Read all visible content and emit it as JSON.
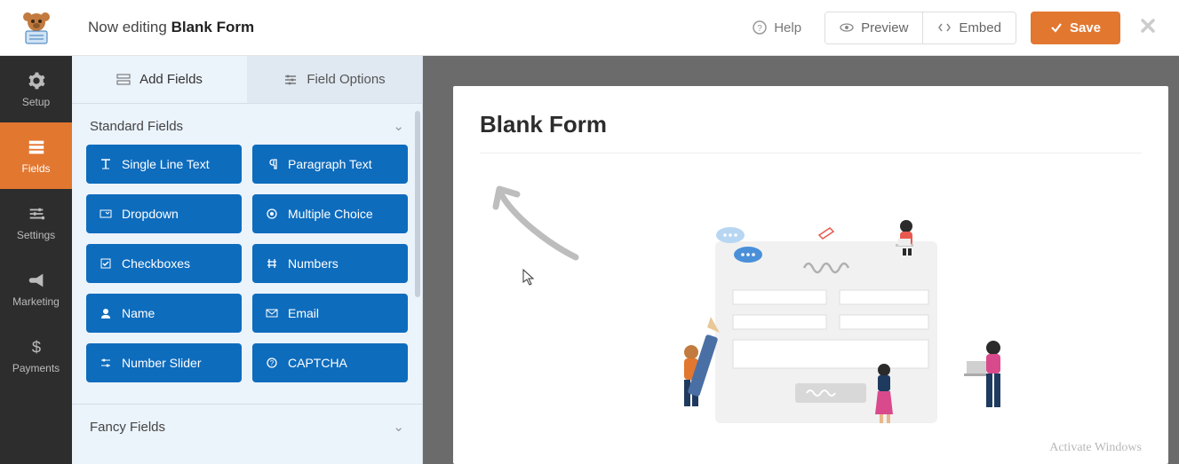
{
  "header": {
    "editing_prefix": "Now editing ",
    "form_name": "Blank Form",
    "help_label": "Help",
    "preview_label": "Preview",
    "embed_label": "Embed",
    "save_label": "Save"
  },
  "vnav": {
    "items": [
      {
        "label": "Setup",
        "icon": "gear-icon"
      },
      {
        "label": "Fields",
        "icon": "form-icon",
        "active": true
      },
      {
        "label": "Settings",
        "icon": "sliders-icon"
      },
      {
        "label": "Marketing",
        "icon": "bullhorn-icon"
      },
      {
        "label": "Payments",
        "icon": "dollar-icon"
      }
    ]
  },
  "panel": {
    "tabs": {
      "add_fields": "Add Fields",
      "field_options": "Field Options"
    },
    "sections": {
      "standard": "Standard Fields",
      "fancy": "Fancy Fields"
    },
    "standard_fields": [
      {
        "label": "Single Line Text",
        "icon": "text-icon"
      },
      {
        "label": "Paragraph Text",
        "icon": "paragraph-icon"
      },
      {
        "label": "Dropdown",
        "icon": "dropdown-icon"
      },
      {
        "label": "Multiple Choice",
        "icon": "radio-icon"
      },
      {
        "label": "Checkboxes",
        "icon": "checkbox-icon"
      },
      {
        "label": "Numbers",
        "icon": "hash-icon"
      },
      {
        "label": "Name",
        "icon": "user-icon"
      },
      {
        "label": "Email",
        "icon": "mail-icon"
      },
      {
        "label": "Number Slider",
        "icon": "slider-icon"
      },
      {
        "label": "CAPTCHA",
        "icon": "captcha-icon"
      }
    ]
  },
  "canvas": {
    "title": "Blank Form"
  },
  "watermark": "Activate Windows"
}
